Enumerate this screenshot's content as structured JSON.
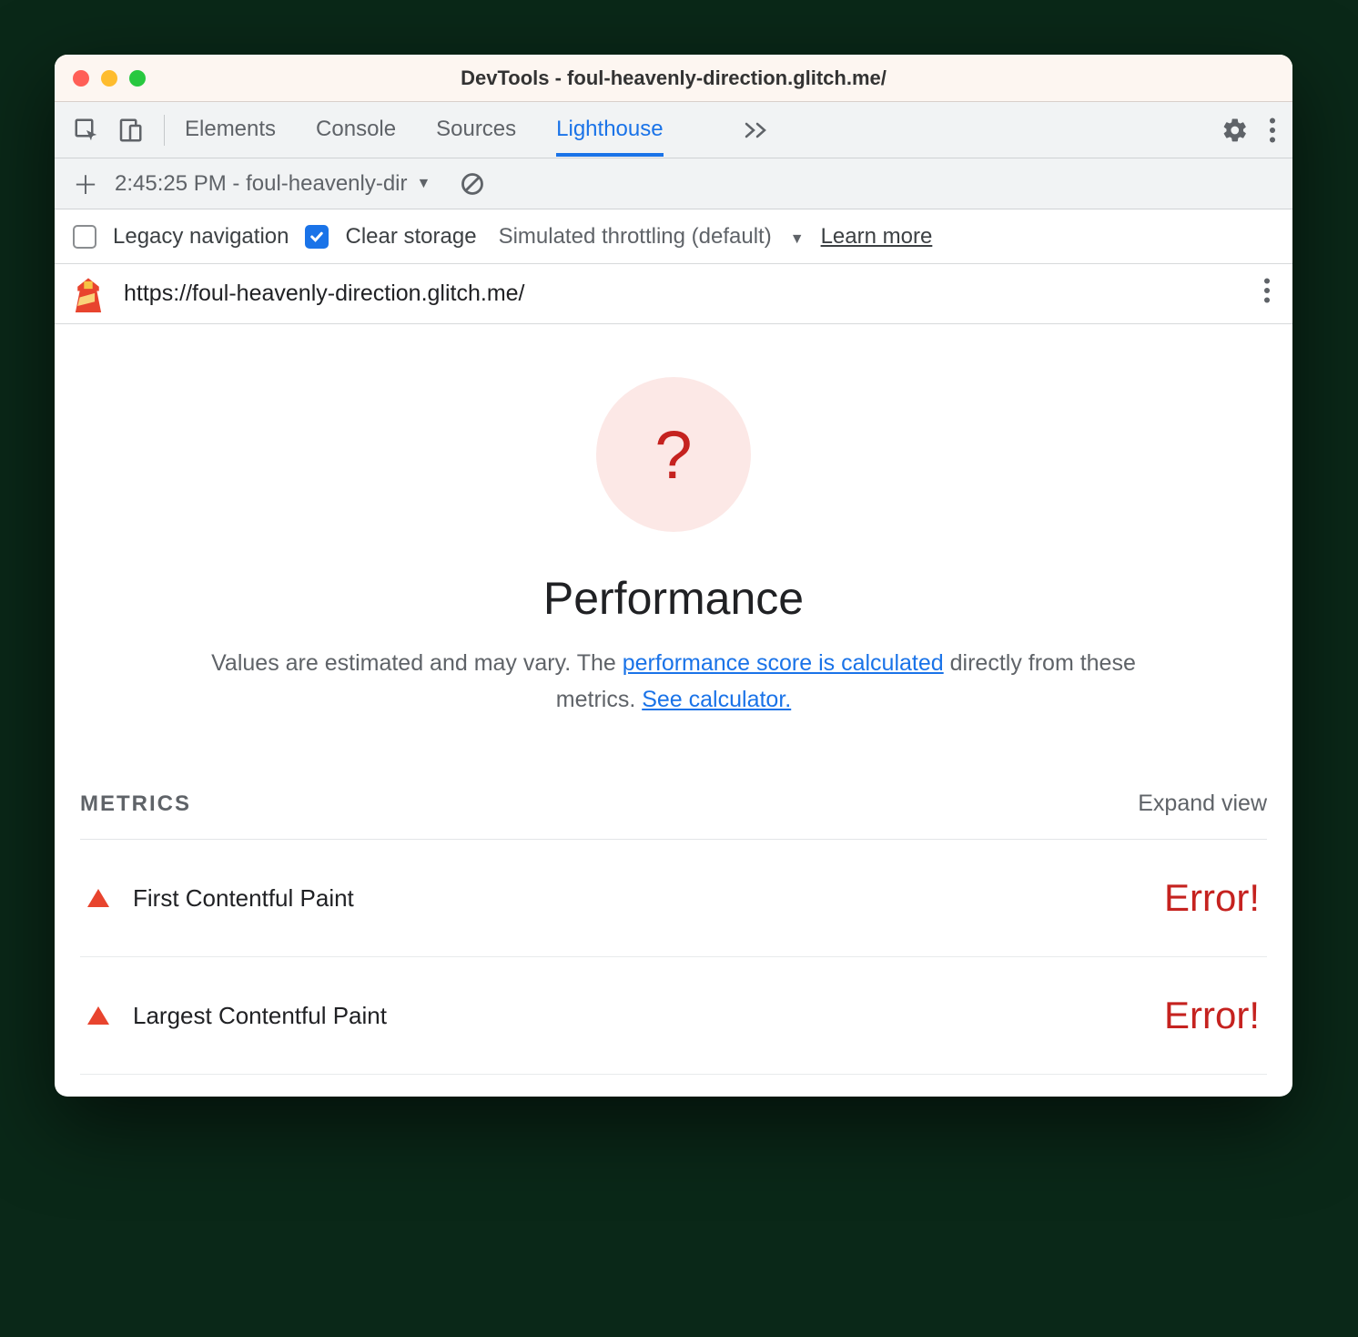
{
  "window": {
    "title": "DevTools - foul-heavenly-direction.glitch.me/"
  },
  "tabs": {
    "items": [
      "Elements",
      "Console",
      "Sources",
      "Lighthouse"
    ],
    "active_index": 3
  },
  "subbar": {
    "report_label": "2:45:25 PM - foul-heavenly-dir"
  },
  "options": {
    "legacy_label": "Legacy navigation",
    "legacy_checked": false,
    "clear_label": "Clear storage",
    "clear_checked": true,
    "throttling_label": "Simulated throttling (default)",
    "learn_more": "Learn more"
  },
  "url": "https://foul-heavenly-direction.glitch.me/",
  "score": {
    "symbol": "?"
  },
  "performance": {
    "title": "Performance",
    "desc_prefix": "Values are estimated and may vary. The ",
    "link1": "performance score is calculated",
    "desc_mid": " directly from these metrics. ",
    "link2": "See calculator."
  },
  "metrics": {
    "header": "METRICS",
    "expand": "Expand view",
    "rows": [
      {
        "name": "First Contentful Paint",
        "value": "Error!"
      },
      {
        "name": "Largest Contentful Paint",
        "value": "Error!"
      }
    ]
  }
}
